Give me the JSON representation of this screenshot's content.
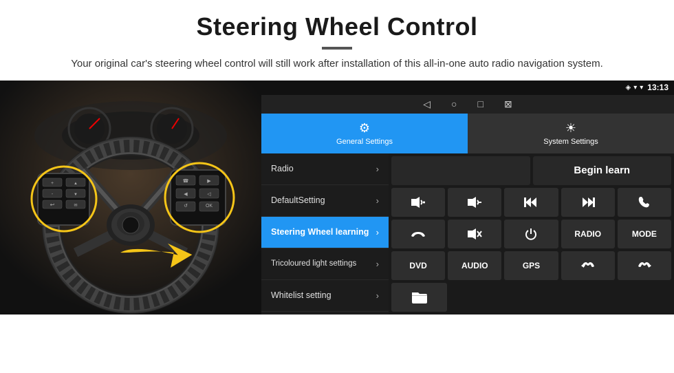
{
  "page": {
    "title": "Steering Wheel Control",
    "divider": "—",
    "subtitle": "Your original car's steering wheel control will still work after installation of this all-in-one auto radio navigation system."
  },
  "status_bar": {
    "time": "13:13",
    "signal_icon": "▾",
    "wifi_icon": "▾",
    "battery_icon": "▮"
  },
  "nav_bar": {
    "back_icon": "◁",
    "home_icon": "○",
    "recent_icon": "□",
    "extra_icon": "⊠"
  },
  "tabs": [
    {
      "label": "General Settings",
      "icon": "⚙",
      "active": true
    },
    {
      "label": "System Settings",
      "icon": "☀",
      "active": false
    }
  ],
  "menu": {
    "items": [
      {
        "label": "Radio",
        "active": false
      },
      {
        "label": "DefaultSetting",
        "active": false
      },
      {
        "label": "Steering Wheel learning",
        "active": true
      },
      {
        "label": "Tricoloured light settings",
        "active": false
      },
      {
        "label": "Whitelist setting",
        "active": false
      }
    ]
  },
  "controls": {
    "begin_learn_label": "Begin learn",
    "buttons_row1": [
      {
        "icon": "🔊+",
        "label": ""
      },
      {
        "icon": "🔊−",
        "label": ""
      },
      {
        "icon": "⏮",
        "label": ""
      },
      {
        "icon": "⏭",
        "label": ""
      },
      {
        "icon": "📞",
        "label": ""
      }
    ],
    "buttons_row2": [
      {
        "icon": "↩",
        "label": ""
      },
      {
        "icon": "🔊✕",
        "label": ""
      },
      {
        "icon": "⏻",
        "label": ""
      },
      {
        "text": "RADIO",
        "label": "RADIO"
      },
      {
        "text": "MODE",
        "label": "MODE"
      }
    ],
    "buttons_row3": [
      {
        "text": "DVD",
        "label": "DVD"
      },
      {
        "text": "AUDIO",
        "label": "AUDIO"
      },
      {
        "text": "GPS",
        "label": "GPS"
      },
      {
        "icon": "📞⏮",
        "label": ""
      },
      {
        "icon": "📞⏭",
        "label": ""
      }
    ],
    "buttons_row4": [
      {
        "icon": "📁",
        "label": ""
      }
    ]
  }
}
